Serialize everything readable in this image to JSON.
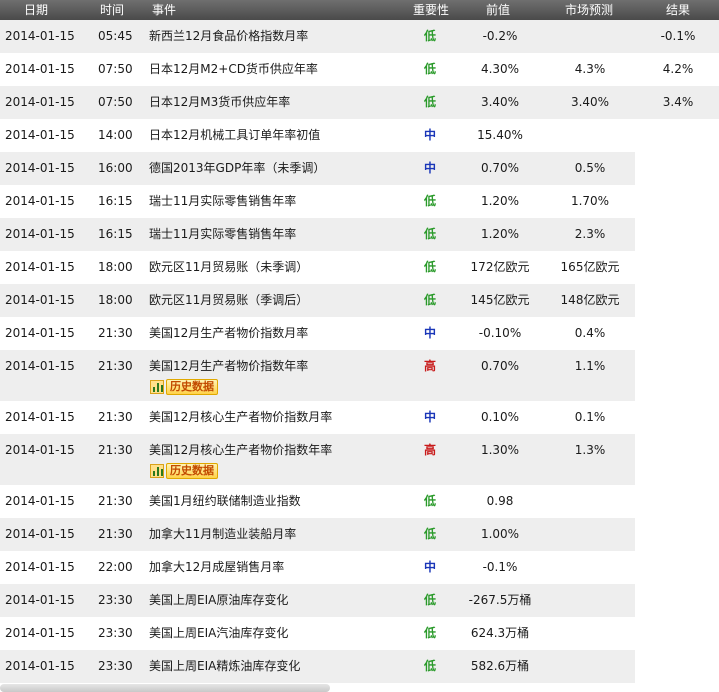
{
  "header": {
    "date": "日期",
    "time": "时间",
    "event": "事件",
    "importance": "重要性",
    "previous": "前值",
    "forecast": "市场预测",
    "result": "结果"
  },
  "history_label": "历史数据",
  "rows": [
    {
      "date": "2014-01-15",
      "time": "05:45",
      "event": "新西兰12月食品价格指数月率",
      "importance": "低",
      "level": "low",
      "previous": "-0.2%",
      "forecast": "",
      "result": "-0.1%",
      "history": false
    },
    {
      "date": "2014-01-15",
      "time": "07:50",
      "event": "日本12月M2+CD货币供应年率",
      "importance": "低",
      "level": "low",
      "previous": "4.30%",
      "forecast": "4.3%",
      "result": "4.2%",
      "history": false
    },
    {
      "date": "2014-01-15",
      "time": "07:50",
      "event": "日本12月M3货币供应年率",
      "importance": "低",
      "level": "low",
      "previous": "3.40%",
      "forecast": "3.40%",
      "result": "3.4%",
      "history": false
    },
    {
      "date": "2014-01-15",
      "time": "14:00",
      "event": "日本12月机械工具订单年率初值",
      "importance": "中",
      "level": "mid",
      "previous": "15.40%",
      "forecast": "",
      "result": "",
      "history": false
    },
    {
      "date": "2014-01-15",
      "time": "16:00",
      "event": "德国2013年GDP年率（未季调）",
      "importance": "中",
      "level": "mid",
      "previous": "0.70%",
      "forecast": "0.5%",
      "result": "",
      "history": false
    },
    {
      "date": "2014-01-15",
      "time": "16:15",
      "event": "瑞士11月实际零售销售年率",
      "importance": "低",
      "level": "low",
      "previous": "1.20%",
      "forecast": "1.70%",
      "result": "",
      "history": false
    },
    {
      "date": "2014-01-15",
      "time": "16:15",
      "event": "瑞士11月实际零售销售年率",
      "importance": "低",
      "level": "low",
      "previous": "1.20%",
      "forecast": "2.3%",
      "result": "",
      "history": false
    },
    {
      "date": "2014-01-15",
      "time": "18:00",
      "event": "欧元区11月贸易账（未季调）",
      "importance": "低",
      "level": "low",
      "previous": "172亿欧元",
      "forecast": "165亿欧元",
      "result": "",
      "history": false
    },
    {
      "date": "2014-01-15",
      "time": "18:00",
      "event": "欧元区11月贸易账（季调后）",
      "importance": "低",
      "level": "low",
      "previous": "145亿欧元",
      "forecast": "148亿欧元",
      "result": "",
      "history": false
    },
    {
      "date": "2014-01-15",
      "time": "21:30",
      "event": "美国12月生产者物价指数月率",
      "importance": "中",
      "level": "mid",
      "previous": "-0.10%",
      "forecast": "0.4%",
      "result": "",
      "history": false
    },
    {
      "date": "2014-01-15",
      "time": "21:30",
      "event": "美国12月生产者物价指数年率",
      "importance": "高",
      "level": "high",
      "previous": "0.70%",
      "forecast": "1.1%",
      "result": "",
      "history": true
    },
    {
      "date": "2014-01-15",
      "time": "21:30",
      "event": "美国12月核心生产者物价指数月率",
      "importance": "中",
      "level": "mid",
      "previous": "0.10%",
      "forecast": "0.1%",
      "result": "",
      "history": false
    },
    {
      "date": "2014-01-15",
      "time": "21:30",
      "event": "美国12月核心生产者物价指数年率",
      "importance": "高",
      "level": "high",
      "previous": "1.30%",
      "forecast": "1.3%",
      "result": "",
      "history": true
    },
    {
      "date": "2014-01-15",
      "time": "21:30",
      "event": "美国1月纽约联储制造业指数",
      "importance": "低",
      "level": "low",
      "previous": "0.98",
      "forecast": "",
      "result": "",
      "history": false
    },
    {
      "date": "2014-01-15",
      "time": "21:30",
      "event": "加拿大11月制造业装船月率",
      "importance": "低",
      "level": "low",
      "previous": "1.00%",
      "forecast": "",
      "result": "",
      "history": false
    },
    {
      "date": "2014-01-15",
      "time": "22:00",
      "event": "加拿大12月成屋销售月率",
      "importance": "中",
      "level": "mid",
      "previous": "-0.1%",
      "forecast": "",
      "result": "",
      "history": false
    },
    {
      "date": "2014-01-15",
      "time": "23:30",
      "event": "美国上周EIA原油库存变化",
      "importance": "低",
      "level": "low",
      "previous": "-267.5万桶",
      "forecast": "",
      "result": "",
      "history": false
    },
    {
      "date": "2014-01-15",
      "time": "23:30",
      "event": "美国上周EIA汽油库存变化",
      "importance": "低",
      "level": "low",
      "previous": "624.3万桶",
      "forecast": "",
      "result": "",
      "history": false
    },
    {
      "date": "2014-01-15",
      "time": "23:30",
      "event": "美国上周EIA精炼油库存变化",
      "importance": "低",
      "level": "low",
      "previous": "582.6万桶",
      "forecast": "",
      "result": "",
      "history": false
    }
  ]
}
